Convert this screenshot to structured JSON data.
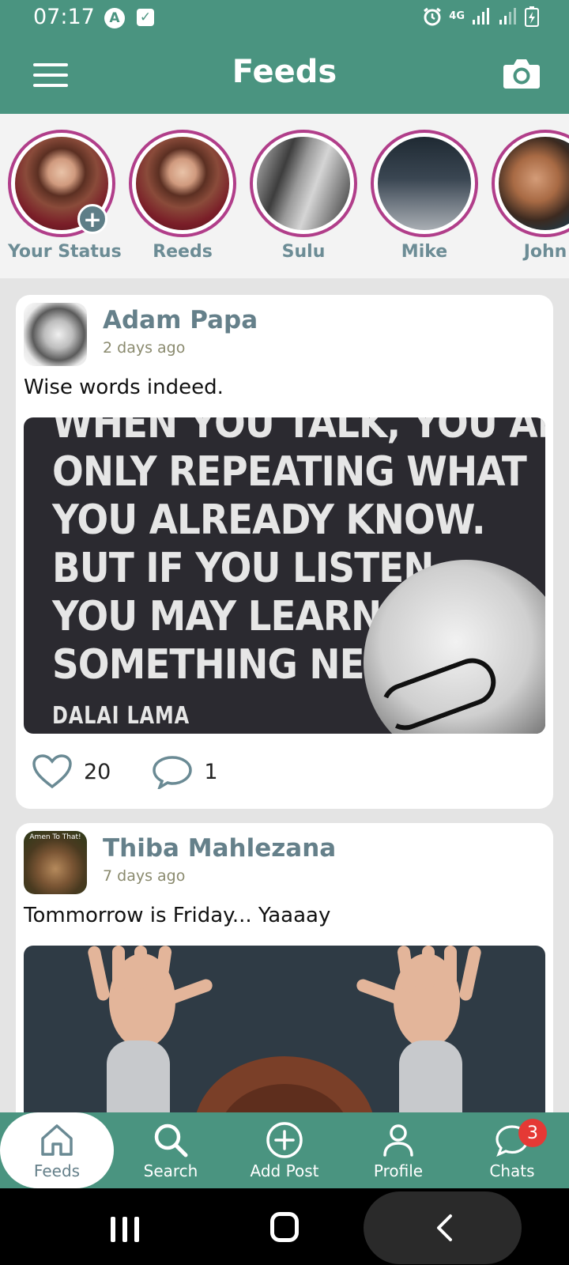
{
  "statusbar": {
    "time": "07:17",
    "network": "4G",
    "icons": [
      "alarm-icon",
      "signal-icon",
      "signal-icon",
      "battery-charging-icon"
    ]
  },
  "appbar": {
    "title": "Feeds",
    "left_icon": "menu-icon",
    "right_icon": "camera-icon"
  },
  "stories": [
    {
      "label": "Your Status",
      "is_own": true
    },
    {
      "label": "Reeds"
    },
    {
      "label": "Sulu"
    },
    {
      "label": "Mike"
    },
    {
      "label": "John"
    }
  ],
  "posts": [
    {
      "author": "Adam Papa",
      "time": "2 days ago",
      "text": "Wise words indeed.",
      "image_quote": {
        "lines": [
          "WHEN YOU TALK, YOU ARE",
          "ONLY REPEATING WHAT",
          "YOU ALREADY KNOW.",
          "BUT IF YOU LISTEN,",
          "YOU MAY LEARN",
          "SOMETHING NEW."
        ],
        "author": "DALAI LAMA"
      },
      "likes": "20",
      "comments": "1"
    },
    {
      "author": "Thiba Mahlezana",
      "time": "7 days ago",
      "text": "Tommorrow is Friday... Yaaaay",
      "avatar_caption": "Amen To That!"
    }
  ],
  "bottomnav": [
    {
      "label": "Feeds",
      "icon": "home-icon",
      "active": true
    },
    {
      "label": "Search",
      "icon": "search-icon"
    },
    {
      "label": "Add Post",
      "icon": "add-circle-icon"
    },
    {
      "label": "Profile",
      "icon": "person-icon"
    },
    {
      "label": "Chats",
      "icon": "chat-icon",
      "badge": "3"
    }
  ],
  "colors": {
    "primary": "#4a9480",
    "story_ring": "#b13e8a",
    "author_text": "#65808a",
    "badge": "#e53935"
  }
}
